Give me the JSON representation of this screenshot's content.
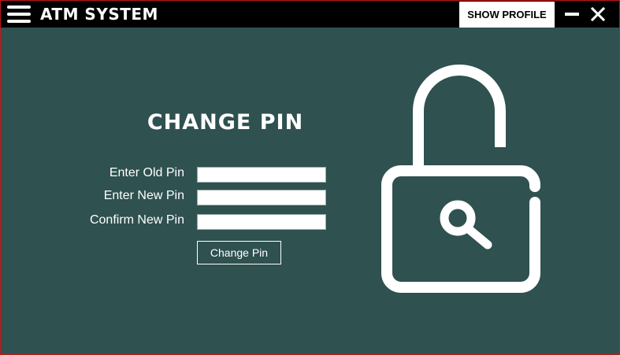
{
  "window": {
    "title": "ATM SYSTEM",
    "show_profile_label": "SHOW PROFILE"
  },
  "icons": {
    "menu": "hamburger-menu-icon",
    "minimize": "minimize-icon",
    "close": "close-icon",
    "illustration": "padlock-search-icon"
  },
  "form": {
    "heading": "CHANGE PIN",
    "old_pin_label": "Enter Old Pin",
    "new_pin_label": "Enter New Pin",
    "confirm_pin_label": "Confirm New Pin",
    "old_pin_value": "",
    "new_pin_value": "",
    "confirm_pin_value": "",
    "submit_label": "Change Pin"
  },
  "colors": {
    "background": "#2f5150",
    "titlebar": "#000000",
    "text": "#ffffff",
    "border": "#c01818"
  }
}
